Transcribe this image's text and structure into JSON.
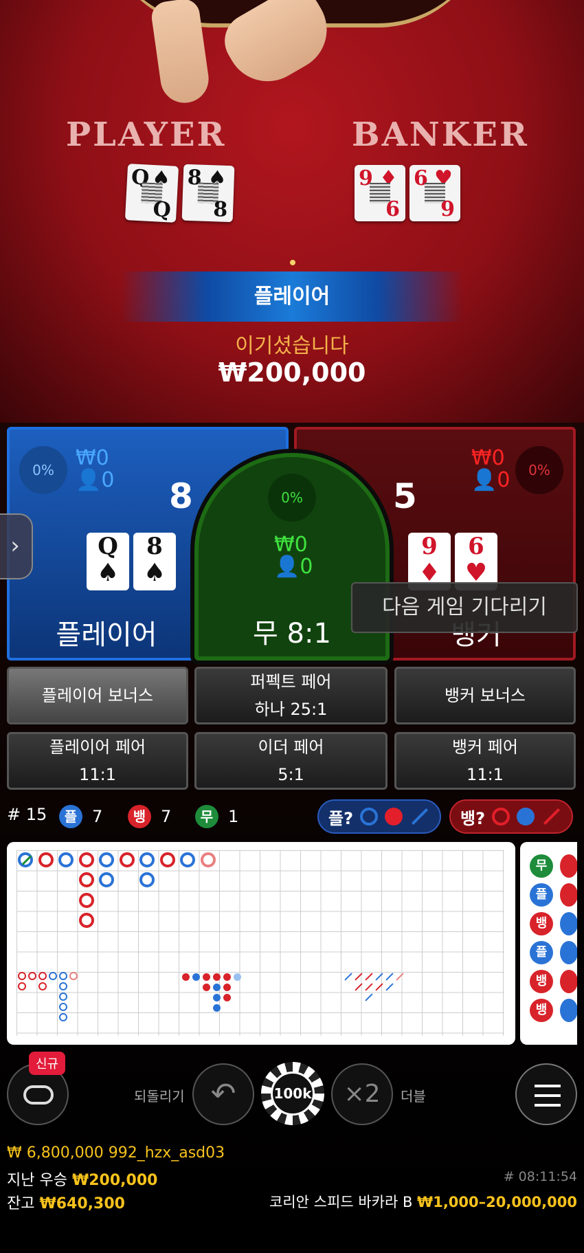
{
  "table": {
    "player_label": "PLAYER",
    "banker_label": "BANKER",
    "player_cards": [
      {
        "rank": "Q",
        "suit": "♠",
        "bottom": "Q"
      },
      {
        "rank": "8",
        "suit": "♠",
        "bottom": "8"
      }
    ],
    "banker_cards": [
      {
        "rank": "9",
        "suit": "♦",
        "bottom": "6"
      },
      {
        "rank": "6",
        "suit": "♥",
        "bottom": "9"
      }
    ],
    "result_banner": "플레이어",
    "win_message": "이기셨습니다",
    "win_amount": "₩200,000"
  },
  "player": {
    "pct": "0%",
    "money": "₩0",
    "people": "0",
    "score": "8",
    "label": "플레이어",
    "cards": [
      {
        "rank": "Q",
        "suit": "♠"
      },
      {
        "rank": "8",
        "suit": "♠"
      }
    ]
  },
  "tie": {
    "pct": "0%",
    "money": "₩0",
    "people": "0",
    "label": "무 8:1"
  },
  "banker": {
    "pct": "0%",
    "money": "₩0",
    "people": "0",
    "score": "5",
    "label": "뱅커",
    "cards": [
      {
        "rank": "9",
        "suit": "♦"
      },
      {
        "rank": "6",
        "suit": "♥"
      }
    ]
  },
  "waiting": "다음 게임 기다리기",
  "side_bets": {
    "player_bonus": "플레이어 보너스",
    "perfect_pair_l1": "퍼펙트 페어",
    "perfect_pair_l2": "하나 25:1",
    "banker_bonus": "뱅커 보너스",
    "player_pair_l1": "플레이어 페어",
    "player_pair_l2": "11:1",
    "either_pair_l1": "이더 페어",
    "either_pair_l2": "5:1",
    "banker_pair_l1": "뱅커 페어",
    "banker_pair_l2": "11:1"
  },
  "stats": {
    "round": "# 15",
    "player_badge": "플",
    "player_count": "7",
    "banker_badge": "뱅",
    "banker_count": "7",
    "tie_badge": "무",
    "tie_count": "1",
    "ask_player": "플?",
    "ask_banker": "뱅?"
  },
  "bead_road": [
    {
      "t": "무",
      "c": "#1e8c3a"
    },
    {
      "t": "플",
      "c": "#2a73d6"
    },
    {
      "t": "뱅",
      "c": "#d8232a"
    },
    {
      "t": "플",
      "c": "#2a73d6"
    },
    {
      "t": "뱅",
      "c": "#d8232a"
    },
    {
      "t": "뱅",
      "c": "#d8232a"
    }
  ],
  "controls": {
    "new_badge": "신규",
    "undo_label": "되돌리기",
    "chip_value": "100k",
    "double_symbol": "×2",
    "double_label": "더블"
  },
  "footer": {
    "balance_line": "₩ 6,800,000 992_hzx_asd03",
    "last_win_label": "지난 우승",
    "last_win_value": "₩200,000",
    "time": "# 08:11:54",
    "balance_label": "잔고",
    "balance_value": "₩640,300",
    "table_name": "코리안 스피드 바카라 B",
    "limits": "₩1,000–20,000,000"
  },
  "colors": {
    "player": "#2a73d6",
    "banker": "#d8232a",
    "tie": "#1e8c3a",
    "gold": "#f7c21c"
  }
}
